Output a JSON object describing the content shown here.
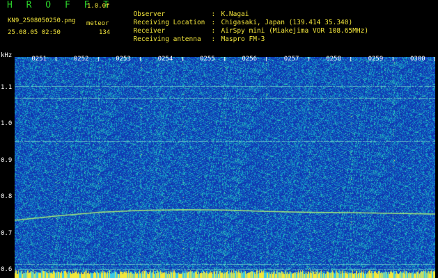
{
  "header": {
    "brand": "H R O F F T",
    "version": "1.0.0f",
    "filename": "KN9_2508050250.png",
    "meteor_label": "meteor",
    "datetime": "25.08.05 02:50",
    "meteor_count": "134"
  },
  "info": [
    {
      "key": "Observer",
      "value": "K.Nagai"
    },
    {
      "key": "Receiving Location",
      "value": "Chigasaki, Japan (139.414 35.340)"
    },
    {
      "key": "Receiver",
      "value": "AirSpy mini (Miakejima VOR 108.65MHz)"
    },
    {
      "key": "Receiving antenna",
      "value": "Maspro FM-3"
    }
  ],
  "colors": {
    "background": "#000000",
    "plot_bg": "#1040b8",
    "header_text": "#f3e63b",
    "brand": "#2bd22b",
    "axis_text": "#ffffff"
  },
  "chart_data": {
    "type": "heatmap",
    "yunit": "kHz",
    "x_tick_labels": [
      "0251",
      "0252",
      "0253",
      "0254",
      "0255",
      "0256",
      "0257",
      "0258",
      "0259",
      "0300"
    ],
    "y_tick_labels": [
      "1.1",
      "1.0",
      "0.9",
      "0.8",
      "0.7",
      "0.6"
    ],
    "y_ticks": [
      1.1,
      1.0,
      0.9,
      0.8,
      0.7,
      0.6
    ],
    "ylim": [
      0.58,
      1.185
    ],
    "xlim_minutes": [
      0,
      10
    ],
    "carrier_trace": [
      {
        "t": 0.0,
        "f": 0.738
      },
      {
        "t": 1.0,
        "f": 0.75
      },
      {
        "t": 2.0,
        "f": 0.76
      },
      {
        "t": 3.0,
        "f": 0.765
      },
      {
        "t": 4.0,
        "f": 0.767
      },
      {
        "t": 5.0,
        "f": 0.766
      },
      {
        "t": 6.0,
        "f": 0.762
      },
      {
        "t": 7.0,
        "f": 0.76
      },
      {
        "t": 8.0,
        "f": 0.759
      },
      {
        "t": 9.0,
        "f": 0.757
      },
      {
        "t": 10.0,
        "f": 0.755
      }
    ],
    "horizontal_lines_khz": [
      1.105,
      1.072,
      0.955,
      0.618,
      0.605
    ]
  }
}
